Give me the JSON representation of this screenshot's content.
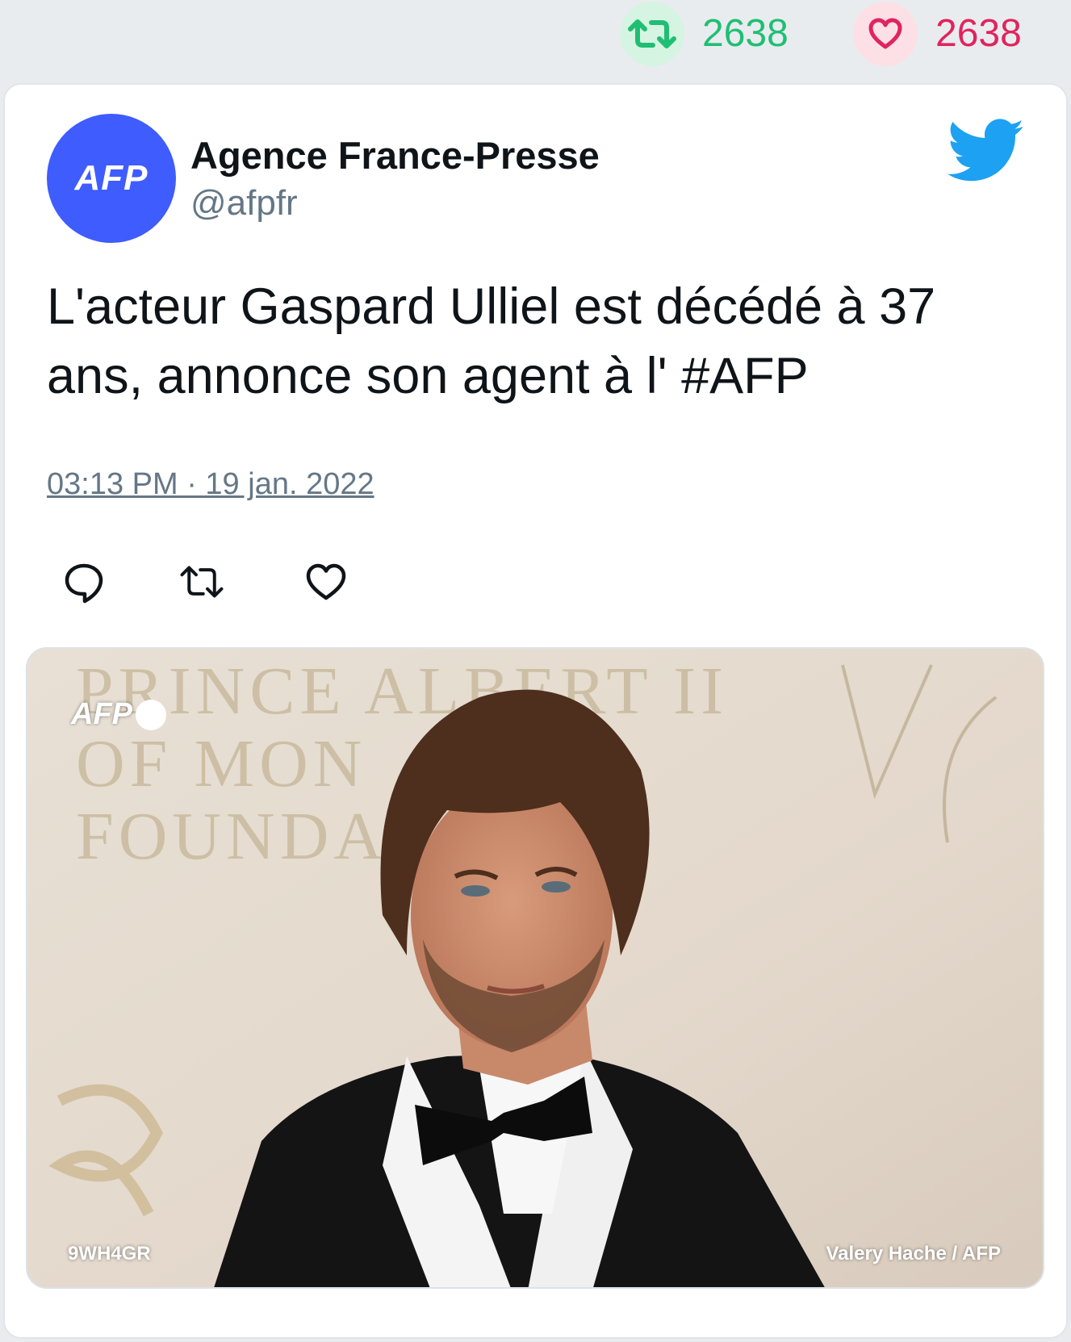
{
  "stats": {
    "retweet_count": "2638",
    "like_count": "2638",
    "colors": {
      "retweet": "#1fbf73",
      "like": "#e0245e"
    }
  },
  "tweet": {
    "author_name": "Agence France-Presse",
    "author_handle": "@afpfr",
    "avatar_text": "AFP",
    "text": "L'acteur Gaspard Ulliel est décédé à 37 ans, annonce son agent à l' #AFP",
    "timestamp": "03:13 PM · 19 jan. 2022",
    "brand_icon": "twitter-bird-icon",
    "actions": [
      "reply-icon",
      "retweet-icon",
      "like-icon"
    ]
  },
  "media": {
    "watermark_logo": "AFP",
    "photo_code": "9WH4GR",
    "credit": "Valery Hache / AFP",
    "backdrop_text": [
      "PRINCE ALBERT II",
      "OF MON",
      "FOUNDA"
    ]
  }
}
